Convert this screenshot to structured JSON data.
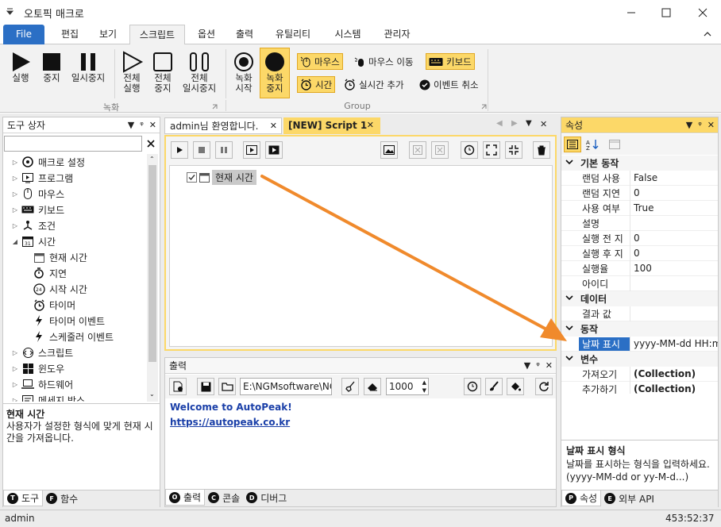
{
  "window": {
    "title": "오토픽 매크로"
  },
  "ribbon_tabs": [
    "File",
    "편집",
    "보기",
    "스크립트",
    "옵션",
    "출력",
    "유틸리티",
    "시스템",
    "관리자"
  ],
  "ribbon": {
    "groups": {
      "record": "녹화",
      "group": "Group"
    },
    "run": "실행",
    "stop": "중지",
    "pause": "일시중지",
    "run_all": [
      "전체",
      "실행"
    ],
    "stop_all": [
      "전체",
      "중지"
    ],
    "pause_all": [
      "전체",
      "일시중지"
    ],
    "rec_start": [
      "녹화",
      "시작"
    ],
    "rec_stop": [
      "녹화",
      "중지"
    ],
    "mouse": "마우스",
    "mouse_move": "마우스 이동",
    "keyboard": "키보드",
    "time": "시간",
    "realtime_add": "실시간 추가",
    "event_cancel": "이벤트 취소"
  },
  "toolbox": {
    "title": "도구 상자",
    "items": [
      {
        "label": "매크로 설정",
        "level": 0,
        "arrow": "▷"
      },
      {
        "label": "프로그램",
        "level": 0,
        "arrow": "▷"
      },
      {
        "label": "마우스",
        "level": 0,
        "arrow": "▷"
      },
      {
        "label": "키보드",
        "level": 0,
        "arrow": "▷"
      },
      {
        "label": "조건",
        "level": 0,
        "arrow": "▷"
      },
      {
        "label": "시간",
        "level": 0,
        "arrow": "◢"
      },
      {
        "label": "현재 시간",
        "level": 1,
        "arrow": ""
      },
      {
        "label": "지연",
        "level": 1,
        "arrow": ""
      },
      {
        "label": "시작 시간",
        "level": 1,
        "arrow": ""
      },
      {
        "label": "타이머",
        "level": 1,
        "arrow": ""
      },
      {
        "label": "타이머 이벤트",
        "level": 1,
        "arrow": ""
      },
      {
        "label": "스케줄러 이벤트",
        "level": 1,
        "arrow": ""
      },
      {
        "label": "스크립트",
        "level": 0,
        "arrow": "▷"
      },
      {
        "label": "윈도우",
        "level": 0,
        "arrow": "▷"
      },
      {
        "label": "하드웨어",
        "level": 0,
        "arrow": "▷"
      },
      {
        "label": "메세지 박스",
        "level": 0,
        "arrow": "▷"
      }
    ],
    "desc_title": "현재 시간",
    "desc_text": "사용자가 설정한 형식에 맞게 현재 시간을 가져옵니다.",
    "bottom_tabs": [
      {
        "badge": "T",
        "label": "도구"
      },
      {
        "badge": "F",
        "label": "함수"
      }
    ]
  },
  "editor": {
    "tabs": [
      "admin님 환영합니다.",
      "[NEW] Script 1"
    ],
    "node_label": "현재 시간"
  },
  "output": {
    "title": "출력",
    "path": "E:\\NGMsoftware\\NG",
    "count": "1000",
    "lines": [
      "Welcome to AutoPeak!",
      "https://autopeak.co.kr"
    ],
    "bottom_tabs": [
      {
        "badge": "O",
        "label": "출력"
      },
      {
        "badge": "C",
        "label": "콘솔"
      },
      {
        "badge": "D",
        "label": "디버그"
      }
    ]
  },
  "properties": {
    "title": "속성",
    "categories": [
      {
        "name": "기본 동작",
        "rows": [
          {
            "name": "랜덤 사용",
            "value": "False"
          },
          {
            "name": "랜덤 지연",
            "value": "0"
          },
          {
            "name": "사용 여부",
            "value": "True"
          },
          {
            "name": "설명",
            "value": ""
          },
          {
            "name": "실행 전 지",
            "value": "0"
          },
          {
            "name": "실행 후 지",
            "value": "0"
          },
          {
            "name": "실행율",
            "value": "100"
          },
          {
            "name": "아이디",
            "value": ""
          }
        ]
      },
      {
        "name": "데이터",
        "rows": [
          {
            "name": "결과 값",
            "value": ""
          }
        ]
      },
      {
        "name": "동작",
        "rows": [
          {
            "name": "날짜 표시",
            "value": "yyyy-MM-dd HH:mm",
            "selected": true
          }
        ]
      },
      {
        "name": "변수",
        "rows": [
          {
            "name": "가져오기",
            "value": "(Collection)",
            "bold": true
          },
          {
            "name": "추가하기",
            "value": "(Collection)",
            "bold": true
          }
        ]
      }
    ],
    "desc_title": "날짜 표시 형식",
    "desc_text": "날짜를 표시하는 형식을 입력하세요. (yyyy-MM-dd or yy-M-d...)",
    "bottom_tabs": [
      {
        "badge": "P",
        "label": "속성"
      },
      {
        "badge": "E",
        "label": "외부 API"
      }
    ]
  },
  "status": {
    "user": "admin",
    "coords": "453:52:37"
  },
  "colors": {
    "accent": "#2b6fc5",
    "highlight": "#fcd868",
    "arrow": "#f08a2c",
    "link": "#1a3fa8"
  }
}
